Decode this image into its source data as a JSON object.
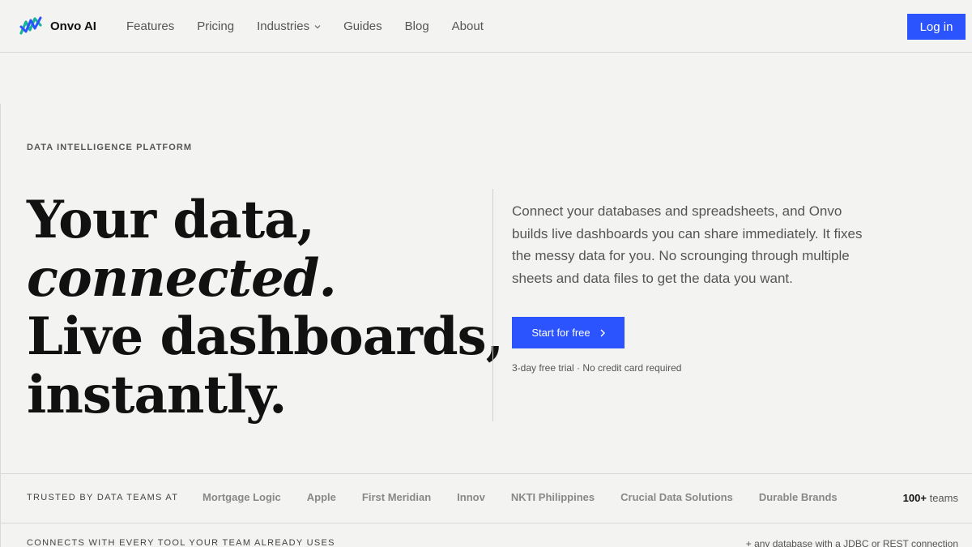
{
  "brand": {
    "name": "Onvo AI",
    "logo_icon": "onvo-wave-logo-icon",
    "accent": "#2b54ff"
  },
  "nav": {
    "items": [
      {
        "label": "Features"
      },
      {
        "label": "Pricing"
      },
      {
        "label": "Industries",
        "has_dropdown": true
      },
      {
        "label": "Guides"
      },
      {
        "label": "Blog"
      },
      {
        "label": "About"
      }
    ],
    "login_label": "Log in"
  },
  "hero": {
    "eyebrow": "DATA INTELLIGENCE PLATFORM",
    "headline": {
      "line1": "Your data,",
      "line2": "connected.",
      "line3": "Live dashboards,",
      "line4": "instantly."
    },
    "description": "Connect your databases and spreadsheets, and Onvo builds live dashboards you can share immediately. It fixes the messy data for you. No scrounging through multiple sheets and data files to get the data you want.",
    "cta_label": "Start for free",
    "cta_icon": "chevron-right-icon",
    "trial_note": "3-day free trial · No credit card required"
  },
  "trusted": {
    "label": "TRUSTED BY DATA TEAMS AT",
    "brands": [
      "Mortgage Logic",
      "Apple",
      "First Meridian",
      "Innov",
      "NKTI Philippines",
      "Crucial Data Solutions",
      "Durable Brands"
    ],
    "count": "100+",
    "count_suffix": "teams"
  },
  "connects": {
    "label": "CONNECTS WITH EVERY TOOL YOUR TEAM ALREADY USES",
    "note": "+ any database with a JDBC or REST connection"
  }
}
